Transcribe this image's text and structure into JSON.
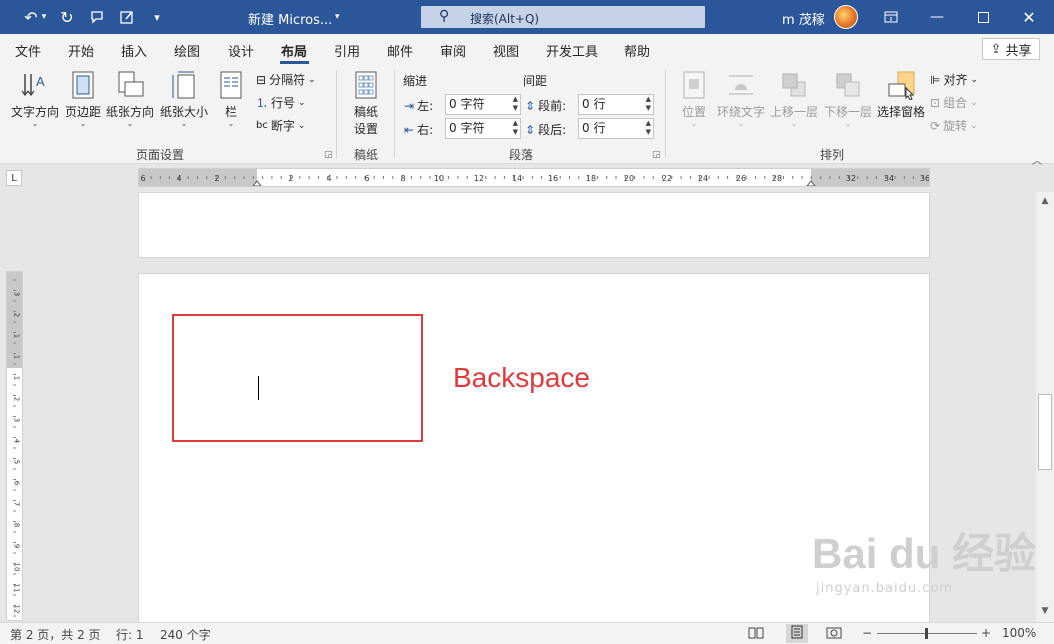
{
  "title_bar": {
    "doc_title": "新建 Micros...",
    "title_arrow": "▾",
    "search_placeholder": "搜索(Alt+Q)",
    "user_name": "m 茂稼"
  },
  "tabs": [
    {
      "label": "文件"
    },
    {
      "label": "开始"
    },
    {
      "label": "插入"
    },
    {
      "label": "绘图"
    },
    {
      "label": "设计"
    },
    {
      "label": "布局",
      "active": true
    },
    {
      "label": "引用"
    },
    {
      "label": "邮件"
    },
    {
      "label": "审阅"
    },
    {
      "label": "视图"
    },
    {
      "label": "开发工具"
    },
    {
      "label": "帮助"
    }
  ],
  "share_label": "共享",
  "ribbon": {
    "page_setup": {
      "text_direction": "文字方向",
      "margins": "页边距",
      "orientation": "纸张方向",
      "size": "纸张大小",
      "columns": "栏",
      "breaks": "分隔符",
      "line_numbers": "行号",
      "hyphenation": "断字",
      "group_label": "页面设置"
    },
    "manuscript": {
      "label_line1": "稿纸",
      "label_line2": "设置",
      "group_label": "稿纸"
    },
    "paragraph": {
      "indent_header": "缩进",
      "spacing_header": "间距",
      "left_label": "左:",
      "right_label": "右:",
      "before_label": "段前:",
      "after_label": "段后:",
      "left_value": "0 字符",
      "right_value": "0 字符",
      "before_value": "0 行",
      "after_value": "0 行",
      "group_label": "段落"
    },
    "arrange": {
      "position": "位置",
      "wrap_text": "环绕文字",
      "bring_forward": "上移一层",
      "send_backward": "下移一层",
      "selection_pane": "选择窗格",
      "align": "对齐",
      "group": "组合",
      "rotate": "旋转",
      "group_label": "排列"
    }
  },
  "ruler": {
    "top_labels": [
      "6",
      "4",
      "2",
      "2",
      "4",
      "6",
      "8",
      "10",
      "12",
      "14",
      "16",
      "18",
      "20",
      "22",
      "24",
      "26",
      "28",
      "32",
      "34",
      "36"
    ],
    "left_labels": [
      "3",
      "2",
      "1",
      "1",
      "1",
      "2",
      "3",
      "4",
      "5",
      "6",
      "7",
      "8",
      "9",
      "10",
      "11",
      "12"
    ]
  },
  "document": {
    "annotation": "Backspace"
  },
  "watermark": {
    "brand": "Bai du 经验",
    "url": "jingyan.baidu.com"
  },
  "status_bar": {
    "page_info": "第 2 页，共 2 页",
    "line_info": "行: 1",
    "word_count": "240 个字",
    "zoom_minus": "−",
    "zoom_plus": "+",
    "zoom_level": "100%"
  }
}
